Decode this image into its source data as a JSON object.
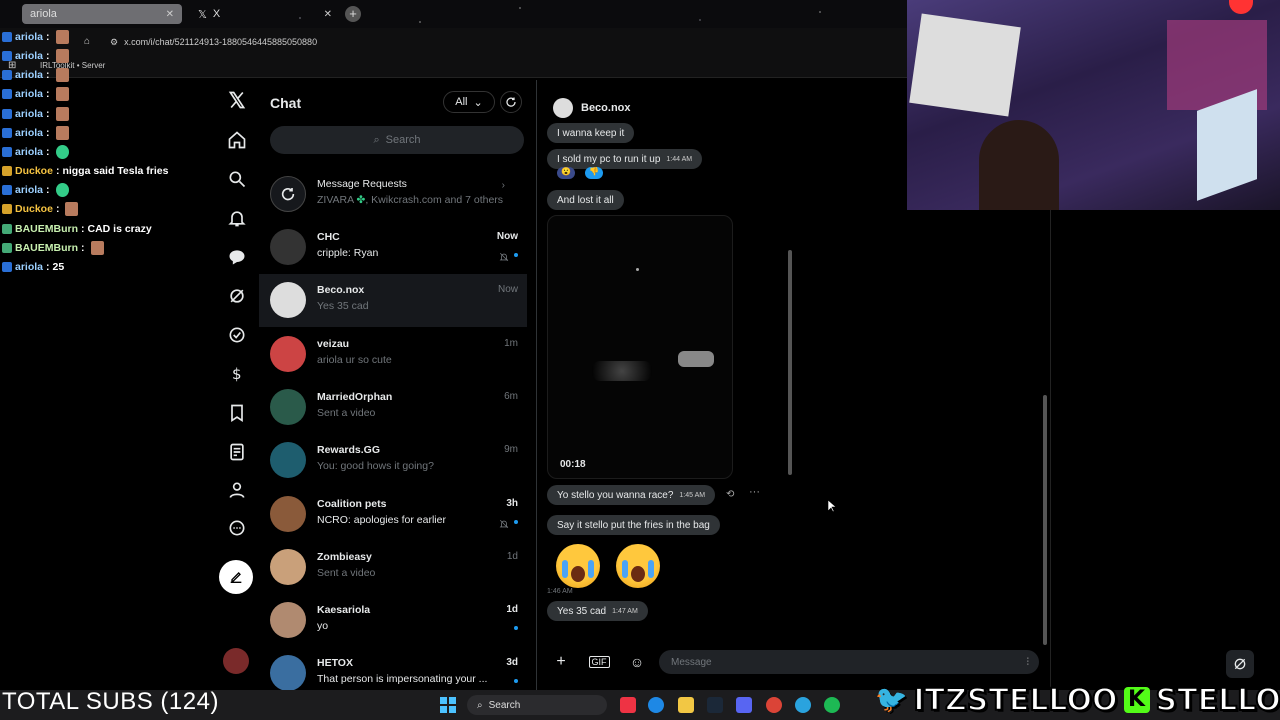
{
  "browser": {
    "tabs": [
      {
        "label": "ariola"
      },
      {
        "label": "X"
      }
    ],
    "url": "x.com/i/chat/521124913-1880546445885050880",
    "bookmark": "IRLToolkit • Server"
  },
  "overlay_chat": [
    {
      "user": "ariola",
      "text": ""
    },
    {
      "user": "ariola",
      "text": ""
    },
    {
      "user": "ariola",
      "text": ""
    },
    {
      "user": "ariola",
      "text": ""
    },
    {
      "user": "ariola",
      "text": ""
    },
    {
      "user": "ariola",
      "text": ""
    },
    {
      "user": "ariola",
      "text": ""
    },
    {
      "user": "Duckoe",
      "text": "nigga said Tesla fries"
    },
    {
      "user": "ariola",
      "text": ""
    },
    {
      "user": "Duckoe",
      "text": ""
    },
    {
      "user": "BAUEMBurn",
      "text": "CAD is crazy"
    },
    {
      "user": "BAUEMBurn",
      "text": ""
    },
    {
      "user": "ariola",
      "text": "25"
    }
  ],
  "nav_icons": [
    "x-logo-icon",
    "home-icon",
    "search-icon",
    "notifications-icon",
    "chat-icon",
    "grok-icon",
    "verified-icon",
    "money-icon",
    "bookmark-icon",
    "lists-icon",
    "profile-icon",
    "more-icon",
    "compose-icon"
  ],
  "chat_list": {
    "title": "Chat",
    "filter": "All",
    "search_placeholder": "Search",
    "requests": {
      "name": "Message Requests",
      "preview": "ZIVARA",
      "preview2": ", Kwikcrash.com and 7 others"
    },
    "conversations": [
      {
        "name": "CHC",
        "preview": "cripple: Ryan",
        "time": "Now",
        "unread": true,
        "muted": true,
        "avatar_color": "#333"
      },
      {
        "name": "Beco.nox",
        "preview": "Yes 35 cad",
        "time": "Now",
        "unread": false,
        "muted": false,
        "avatar_color": "#ddd"
      },
      {
        "name": "veizau",
        "preview": "ariola ur so cute",
        "time": "1m",
        "unread": false,
        "muted": false,
        "avatar_color": "#c44"
      },
      {
        "name": "MarriedOrphan",
        "preview": "Sent a video",
        "time": "6m",
        "unread": false,
        "muted": false,
        "avatar_color": "#2a5a4a"
      },
      {
        "name": "Rewards.GG",
        "preview": "You: good hows it going?",
        "time": "9m",
        "unread": false,
        "muted": false,
        "avatar_color": "#1e5d6e"
      },
      {
        "name": "Coalition pets",
        "preview": "NCRO: apologies for earlier",
        "time": "3h",
        "unread": true,
        "muted": true,
        "avatar_color": "#8a5a3a"
      },
      {
        "name": "Zombieasy",
        "preview": "Sent a video",
        "time": "1d",
        "unread": false,
        "muted": false,
        "avatar_color": "#c9a07a"
      },
      {
        "name": "Kaesariola",
        "preview": "yo",
        "time": "1d",
        "unread": true,
        "muted": false,
        "avatar_color": "#b08a70"
      },
      {
        "name": "HETOX",
        "preview": "That person is impersonating your ...",
        "time": "3d",
        "unread": true,
        "muted": false,
        "avatar_color": "#3a6ea0"
      }
    ]
  },
  "conversation": {
    "name": "Beco.nox",
    "messages": [
      {
        "text": "I wanna keep it",
        "time": ""
      },
      {
        "text": "I sold my pc to run it up",
        "time": "1:44 AM"
      },
      {
        "text": "And lost it all",
        "time": ""
      },
      {
        "text": "Yo stello you wanna race?",
        "time": "1:45 AM"
      },
      {
        "text": "Say it stello put the fries in the bag",
        "time": ""
      },
      {
        "text": "Yes 35 cad",
        "time": "1:47 AM"
      }
    ],
    "video_duration": "00:18",
    "emoji_time": "1:46 AM",
    "compose_placeholder": "Message"
  },
  "stream": {
    "total_subs": "TOTAL SUBS (124)",
    "socials": [
      "ITZSTELLOO",
      "STELLOOO"
    ],
    "taskbar_search": "Search"
  },
  "colors": {
    "accent": "#1d9bf0",
    "bubble": "#2f3336",
    "background": "#000000"
  }
}
